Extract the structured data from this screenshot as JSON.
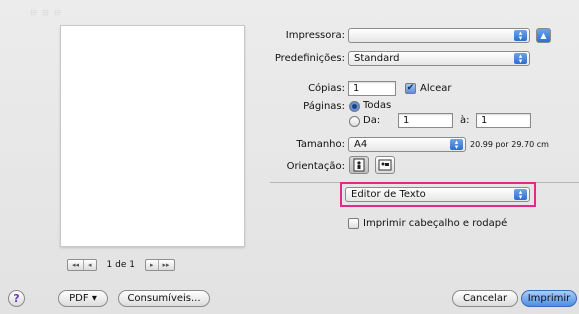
{
  "printer": {
    "label": "Impressora:",
    "value": ""
  },
  "presets": {
    "label": "Predefinições:",
    "value": "Standard"
  },
  "copies": {
    "label": "Cópias:",
    "value": "1",
    "collate_label": "Alcear",
    "collate_checked": true
  },
  "pages": {
    "label": "Páginas:",
    "all_label": "Todas",
    "from_label": "Da:",
    "from_value": "1",
    "to_label": "à:",
    "to_value": "1",
    "selected": "all"
  },
  "paper_size": {
    "label": "Tamanho:",
    "value": "A4",
    "dimensions": "20.99 por 29.70 cm"
  },
  "orientation": {
    "label": "Orientação:"
  },
  "panel": {
    "value": "Editor de Texto"
  },
  "header_footer": {
    "label": "Imprimir cabeçalho e rodapé",
    "checked": false
  },
  "pager": {
    "page_text": "1 de 1",
    "first": "◂◂",
    "prev": "◂",
    "next": "▸",
    "last": "▸▸"
  },
  "bottom": {
    "help": "?",
    "pdf": "PDF ▾",
    "supplies": "Consumíveis...",
    "cancel": "Cancelar",
    "print": "Imprimir"
  },
  "colors": {
    "highlight": "#e8278a",
    "accent": "#2c6fd2"
  }
}
